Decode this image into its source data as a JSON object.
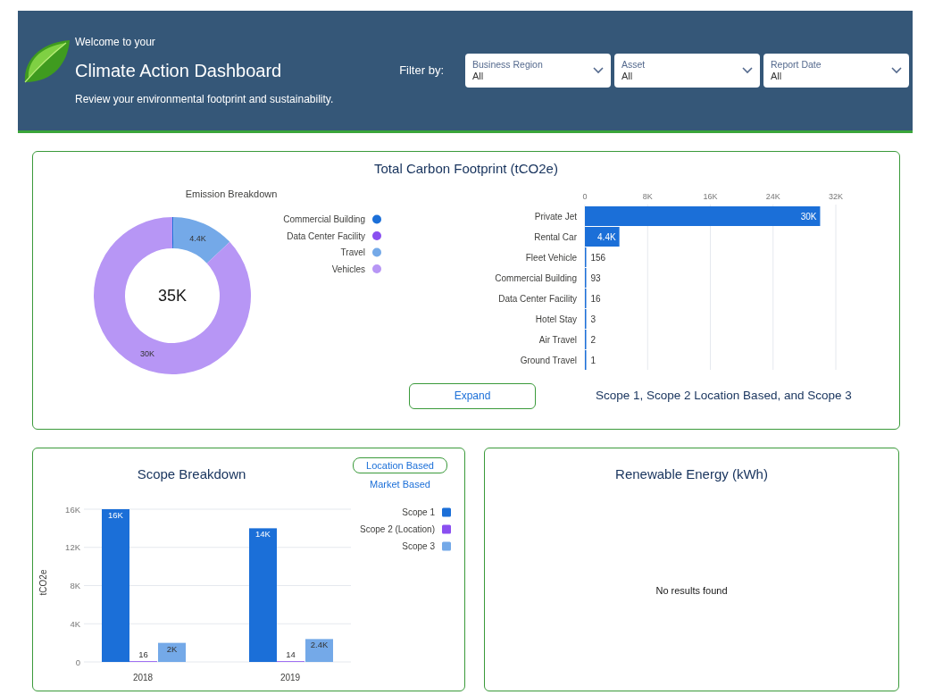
{
  "header": {
    "greeting": "Welcome to your",
    "title": "Climate Action Dashboard",
    "subtitle": "Review your environmental footprint and sustainability.",
    "filter_label": "Filter by:",
    "filters": [
      {
        "label": "Business Region",
        "value": "All"
      },
      {
        "label": "Asset",
        "value": "All"
      },
      {
        "label": "Report Date",
        "value": "All"
      }
    ]
  },
  "footprint": {
    "title": "Total Carbon Footprint (tCO2e)",
    "donut": {
      "center_label": "35K",
      "chart_data": {
        "type": "donut",
        "title": "Emission Breakdown",
        "categories": [
          "Commercial Building",
          "Data Center Facility",
          "Travel",
          "Vehicles"
        ],
        "colors": [
          "#1b6fd8",
          "#8a4ff0",
          "#74a9e8",
          "#b796f5"
        ],
        "values": [
          93,
          null,
          4400,
          30000
        ],
        "value_labels": [
          null,
          null,
          "4.4K",
          "30K"
        ],
        "legend": true
      }
    },
    "bar_chart": {
      "chart_data": {
        "type": "bar",
        "orientation": "horizontal",
        "categories": [
          "Private Jet",
          "Rental Car",
          "Fleet Vehicle",
          "Commercial Building",
          "Data Center Facility",
          "Hotel Stay",
          "Air Travel",
          "Ground Travel"
        ],
        "series": [
          {
            "color": "#1b6fd8",
            "values": [
              30000,
              4400,
              156,
              93,
              16,
              3,
              2,
              1
            ]
          }
        ],
        "value_labels": [
          "30K",
          "4.4K",
          "156",
          "93",
          "16",
          "3",
          "2",
          "1"
        ],
        "xlim": [
          0,
          32000
        ],
        "grid": true,
        "xticks": [
          {
            "value": 0,
            "label": "0"
          },
          {
            "value": 8000,
            "label": "8K"
          },
          {
            "value": 16000,
            "label": "16K"
          },
          {
            "value": 24000,
            "label": "24K"
          },
          {
            "value": 32000,
            "label": "32K"
          }
        ]
      }
    },
    "expand_button": "Expand",
    "caption": "Scope 1, Scope 2 Location Based, and Scope 3"
  },
  "scope": {
    "title": "Scope Breakdown",
    "toggle": [
      {
        "label": "Location Based",
        "selected": true
      },
      {
        "label": "Market Based",
        "selected": false
      }
    ],
    "chart_data": {
      "type": "bar",
      "ylabel": "tCO2e",
      "categories": [
        "2018",
        "2019"
      ],
      "series": [
        {
          "name": "Scope 1",
          "color": "#1b6fd8",
          "values": [
            16000,
            14000
          ],
          "value_labels": [
            "16K",
            "14K"
          ]
        },
        {
          "name": "Scope 2 (Location)",
          "color": "#8a4ff0",
          "values": [
            16,
            14
          ],
          "value_labels": [
            "16",
            "14"
          ]
        },
        {
          "name": "Scope 3",
          "color": "#74a9e8",
          "values": [
            2000,
            2400
          ],
          "value_labels": [
            "2K",
            "2.4K"
          ]
        }
      ],
      "ylim": [
        0,
        16000
      ],
      "grid": true,
      "legend": true,
      "yticks": [
        {
          "value": 0,
          "label": "0"
        },
        {
          "value": 4000,
          "label": "4K"
        },
        {
          "value": 8000,
          "label": "8K"
        },
        {
          "value": 12000,
          "label": "12K"
        },
        {
          "value": 16000,
          "label": "16K"
        }
      ]
    }
  },
  "renewable": {
    "title": "Renewable Energy (kWh)",
    "empty_message": "No results found"
  }
}
